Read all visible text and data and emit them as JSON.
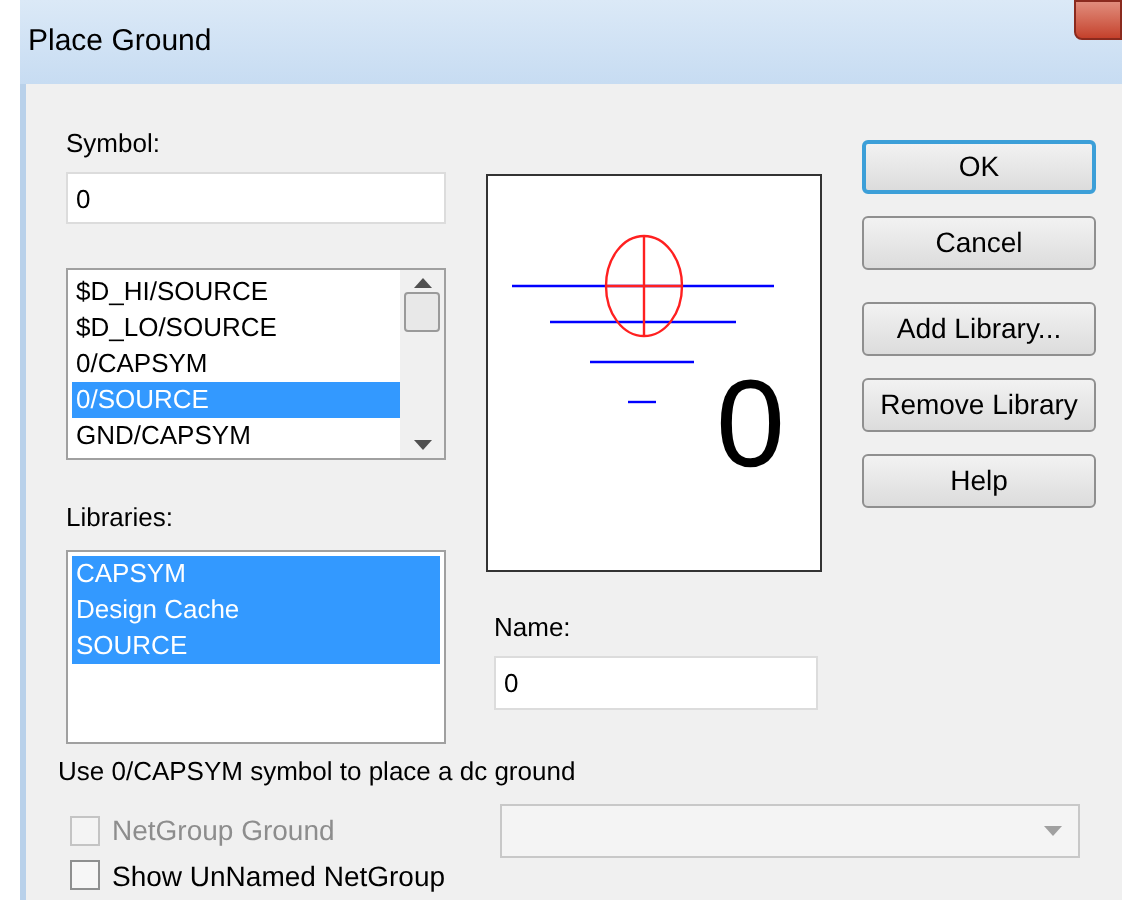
{
  "window": {
    "title": "Place Ground"
  },
  "symbol": {
    "label": "Symbol:",
    "value": "0"
  },
  "symbols": [
    {
      "label": "$D_HI/SOURCE",
      "selected": false
    },
    {
      "label": "$D_LO/SOURCE",
      "selected": false
    },
    {
      "label": "0/CAPSYM",
      "selected": false
    },
    {
      "label": "0/SOURCE",
      "selected": true
    },
    {
      "label": "GND/CAPSYM",
      "selected": false
    }
  ],
  "libraries": {
    "label": "Libraries:",
    "items": [
      {
        "label": "CAPSYM",
        "selected": true
      },
      {
        "label": "Design Cache",
        "selected": true
      },
      {
        "label": "SOURCE",
        "selected": true
      }
    ]
  },
  "preview": {
    "label": "0"
  },
  "name": {
    "label": "Name:",
    "value": "0"
  },
  "buttons": [
    {
      "label": "OK",
      "focused": true
    },
    {
      "label": "Cancel",
      "focused": false
    },
    {
      "label": "Add Library...",
      "focused": false
    },
    {
      "label": "Remove Library",
      "focused": false
    },
    {
      "label": "Help",
      "focused": false
    }
  ],
  "hint": "Use 0/CAPSYM symbol to place a dc ground",
  "checkboxes": [
    {
      "label": "NetGroup Ground",
      "checked": false,
      "disabled": true
    },
    {
      "label": "Show UnNamed NetGroup",
      "checked": false,
      "disabled": false
    }
  ],
  "netgroup_dropdown": {
    "disabled": true
  }
}
